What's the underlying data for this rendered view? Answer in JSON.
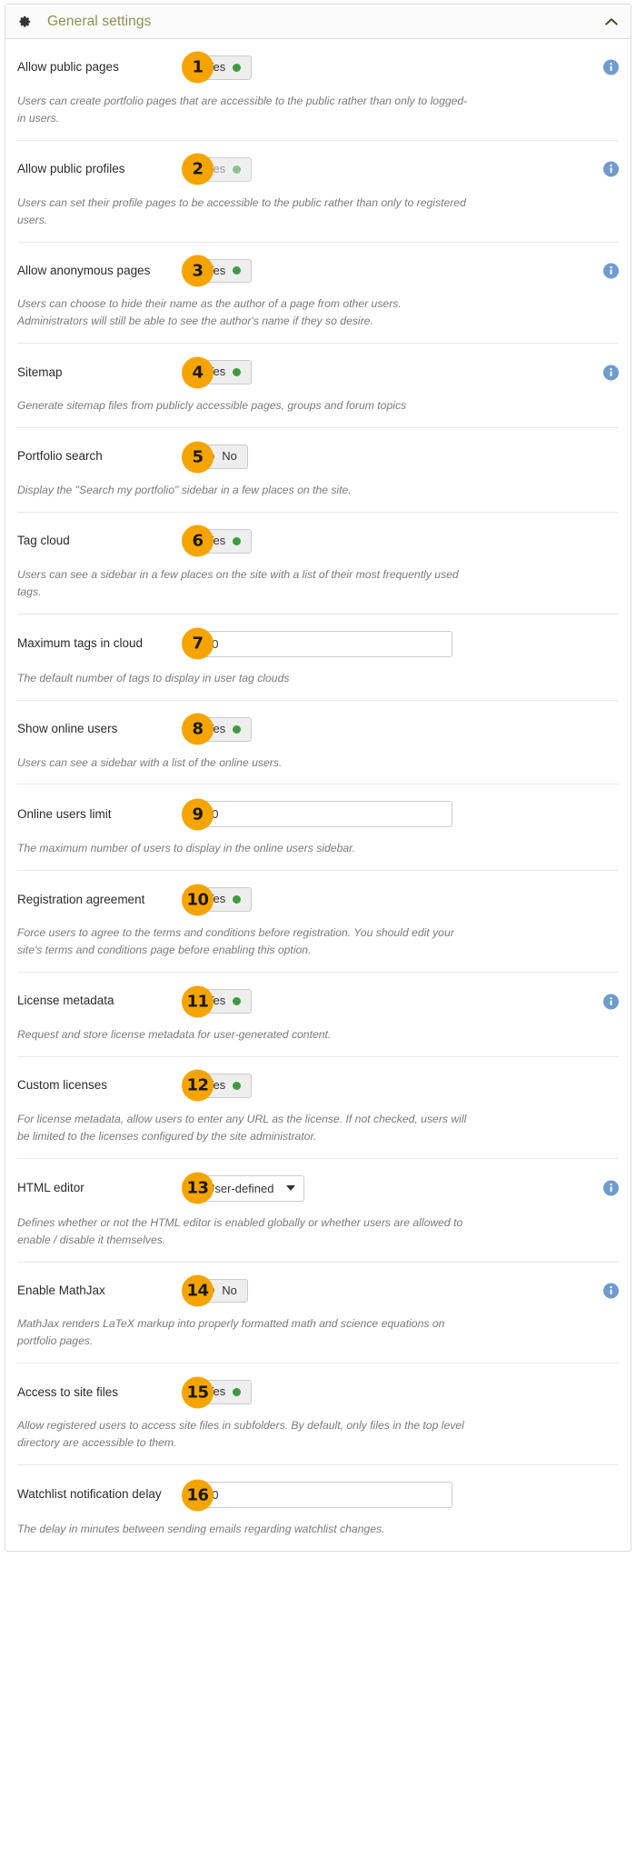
{
  "header": {
    "title": "General settings",
    "gear_icon": "gear-icon",
    "collapse_icon": "chevron-up-icon"
  },
  "labels": {
    "yes": "Yes",
    "no": "No",
    "info_icon": "info-icon"
  },
  "rows": [
    {
      "number": "1",
      "label": "Allow public pages",
      "control": "toggle",
      "value": "Yes",
      "state": "on",
      "disabled": false,
      "info": true,
      "description": "Users can create portfolio pages that are accessible to the public rather than only to logged-in users."
    },
    {
      "number": "2",
      "label": "Allow public profiles",
      "control": "toggle",
      "value": "Yes",
      "state": "on",
      "disabled": true,
      "info": true,
      "description": "Users can set their profile pages to be accessible to the public rather than only to registered users."
    },
    {
      "number": "3",
      "label": "Allow anonymous pages",
      "control": "toggle",
      "value": "Yes",
      "state": "on",
      "disabled": false,
      "info": true,
      "description": "Users can choose to hide their name as the author of a page from other users. Administrators will still be able to see the author's name if they so desire."
    },
    {
      "number": "4",
      "label": "Sitemap",
      "control": "toggle",
      "value": "Yes",
      "state": "on",
      "disabled": false,
      "info": true,
      "description": "Generate sitemap files from publicly accessible pages, groups and forum topics"
    },
    {
      "number": "5",
      "label": "Portfolio search",
      "control": "toggle",
      "value": "No",
      "state": "off",
      "disabled": false,
      "info": false,
      "description": "Display the \"Search my portfolio\" sidebar in a few places on the site."
    },
    {
      "number": "6",
      "label": "Tag cloud",
      "control": "toggle",
      "value": "Yes",
      "state": "on",
      "disabled": false,
      "info": false,
      "description": "Users can see a sidebar in a few places on the site with a list of their most frequently used tags."
    },
    {
      "number": "7",
      "label": "Maximum tags in cloud",
      "control": "input",
      "value": "20",
      "info": false,
      "description": "The default number of tags to display in user tag clouds"
    },
    {
      "number": "8",
      "label": "Show online users",
      "control": "toggle",
      "value": "Yes",
      "state": "on",
      "disabled": false,
      "info": false,
      "description": "Users can see a sidebar with a list of the online users."
    },
    {
      "number": "9",
      "label": "Online users limit",
      "control": "input",
      "value": "10",
      "info": false,
      "description": "The maximum number of users to display in the online users sidebar."
    },
    {
      "number": "10",
      "label": "Registration agreement",
      "control": "toggle",
      "value": "Yes",
      "state": "on",
      "disabled": false,
      "info": false,
      "description": "Force users to agree to the terms and conditions before registration. You should edit your site's terms and conditions page before enabling this option."
    },
    {
      "number": "11",
      "label": "License metadata",
      "control": "toggle",
      "value": "Yes",
      "state": "on",
      "disabled": false,
      "info": true,
      "description": "Request and store license metadata for user-generated content."
    },
    {
      "number": "12",
      "label": "Custom licenses",
      "control": "toggle",
      "value": "Yes",
      "state": "on",
      "disabled": false,
      "info": false,
      "description": "For license metadata, allow users to enter any URL as the license. If not checked, users will be limited to the licenses configured by the site administrator."
    },
    {
      "number": "13",
      "label": "HTML editor",
      "control": "select",
      "value": "User-defined",
      "info": true,
      "description": "Defines whether or not the HTML editor is enabled globally or whether users are allowed to enable / disable it themselves."
    },
    {
      "number": "14",
      "label": "Enable MathJax",
      "control": "toggle",
      "value": "No",
      "state": "off",
      "disabled": false,
      "info": true,
      "description": "MathJax renders LaTeX markup into properly formatted math and science equations on portfolio pages."
    },
    {
      "number": "15",
      "label": "Access to site files",
      "control": "toggle",
      "value": "Yes",
      "state": "on",
      "disabled": false,
      "info": false,
      "description": "Allow registered users to access site files in subfolders. By default, only files in the top level directory are accessible to them."
    },
    {
      "number": "16",
      "label": "Watchlist notification delay",
      "control": "input",
      "value": "20",
      "info": false,
      "description": "The delay in minutes between sending emails regarding watchlist changes."
    }
  ],
  "colors": {
    "badge": "#f5a401",
    "title": "#8a9152",
    "info": "#6f9bd1",
    "on": "#3f9a3f",
    "off": "#e8584f"
  }
}
